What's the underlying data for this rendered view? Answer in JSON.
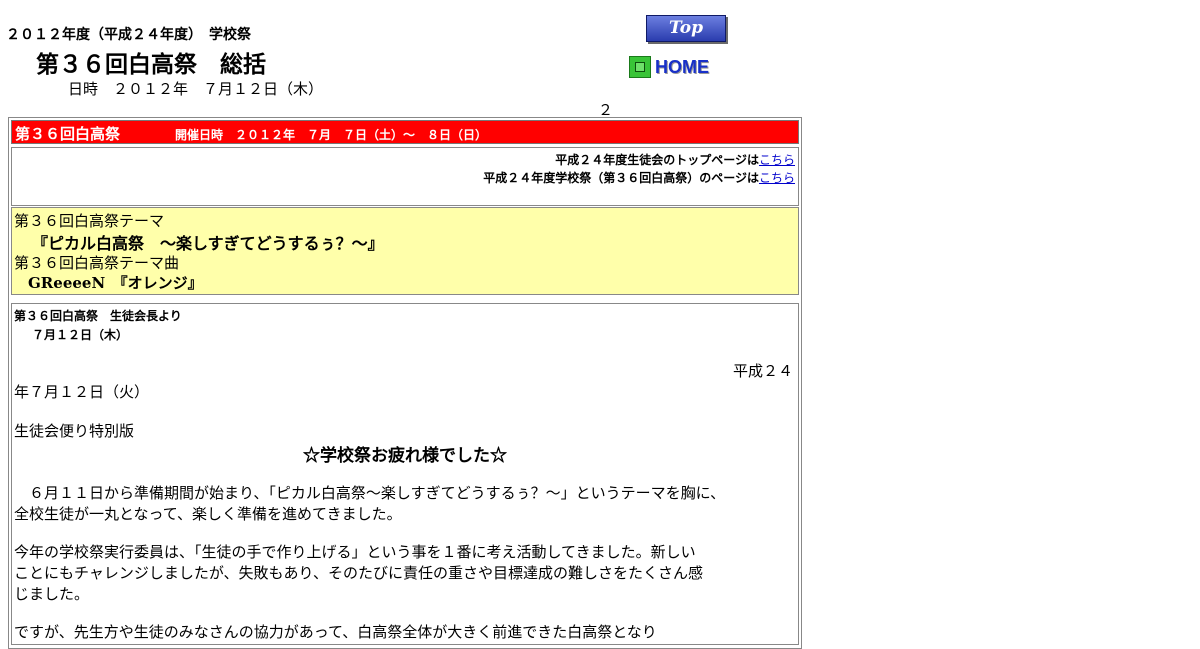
{
  "header": {
    "sub_title": "２０１２年度（平成２４年度）　学校祭",
    "main_title": "第３６回白高祭　総括",
    "date_line": "日時　２０１２年　７月１２日（木）",
    "page_number": "２"
  },
  "nav": {
    "top_label": "Top",
    "home_label": "HOME"
  },
  "festival_header": {
    "name": "第３６回白高祭",
    "dates": "開催日時　２０１２年　７月　７日（土）～　８日（日）"
  },
  "links": [
    {
      "text": "平成２４年度生徒会のトップページは",
      "link": "こちら"
    },
    {
      "text": "平成２４年度学校祭（第３６回白高祭）のページは",
      "link": "こちら"
    }
  ],
  "theme": {
    "label": "第３６回白高祭テーマ",
    "text": "『ピカル白高祭　～楽しすぎてどうするぅ？～』",
    "song_label": "第３６回白高祭テーマ曲",
    "song": "GReeeeN　『オレンジ』"
  },
  "message": {
    "heading": "第３６回白高祭　生徒会長より",
    "date": "７月１２日（木）",
    "heisei_a": "平成２４",
    "heisei_b": "年７月１２日（火）",
    "bulletin": "生徒会便り特別版",
    "thanks": "☆学校祭お疲れ様でした☆",
    "p1_l1": "　６月１１日から準備期間が始まり、「ピカル白高祭～楽しすぎてどうするぅ？～」というテーマを胸に、",
    "p1_l2": "全校生徒が一丸となって、楽しく準備を進めてきました。",
    "p2_l1": "今年の学校祭実行委員は、「生徒の手で作り上げる」という事を１番に考え活動してきました。新しい",
    "p2_l2": "ことにもチャレンジしましたが、失敗もあり、そのたびに責任の重さや目標達成の難しさをたくさん感",
    "p2_l3": "じました。",
    "p3_l1": "ですが、先生方や生徒のみなさんの協力があって、白高祭全体が大きく前進できた白高祭となり"
  },
  "colors": {
    "header_red": "#ff0000",
    "theme_yellow": "#ffffaa",
    "link_blue": "#0000cc"
  }
}
